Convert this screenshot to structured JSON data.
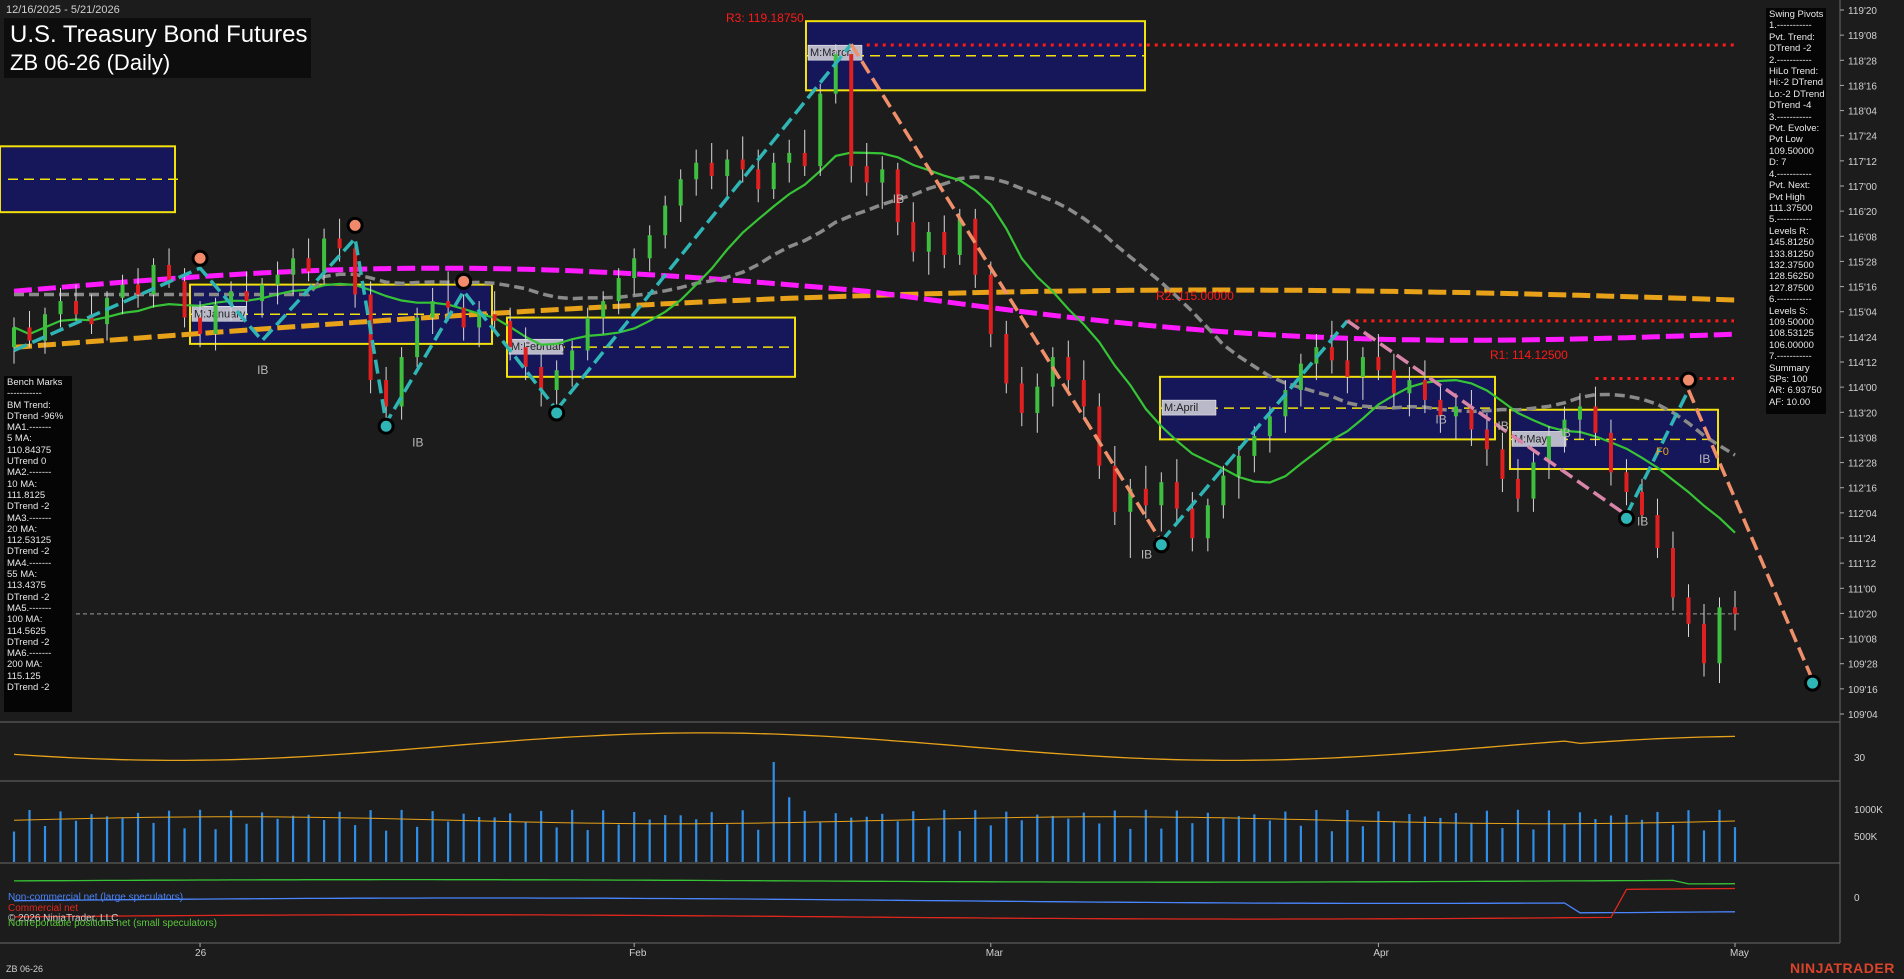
{
  "header": {
    "date_range": "12/16/2025 - 5/21/2026",
    "title": "U.S. Treasury Bond Futures",
    "subtitle": "ZB 06-26 (Daily)"
  },
  "bench_marks": {
    "lines": [
      "Bench Marks",
      "-----------",
      "BM Trend:",
      "DTrend -96%",
      "MA1.-------",
      "5 MA:",
      "110.84375",
      "UTrend 0",
      "MA2.-------",
      "10 MA:",
      "111.8125",
      "DTrend -2",
      "MA3.-------",
      "20 MA:",
      "112.53125",
      "DTrend -2",
      "MA4.-------",
      "55 MA:",
      "113.4375",
      "DTrend -2",
      "MA5.-------",
      "100 MA:",
      "114.5625",
      "DTrend -2",
      "MA6.-------",
      "200 MA:",
      "115.125",
      "DTrend -2"
    ]
  },
  "swing_pivots": {
    "lines": [
      "Swing Pivots",
      "1.-----------",
      "Pvt. Trend:",
      "DTrend -2",
      "2.-----------",
      "HiLo Trend:",
      "Hi:-2 DTrend",
      "Lo:-2 DTrend",
      "DTrend -4",
      "3.-----------",
      "Pvt. Evolve:",
      "Pvt Low",
      "109.50000",
      "D: 7",
      "4.-----------",
      "Pvt. Next:",
      "Pvt High",
      "111.37500",
      "5.-----------",
      "Levels R:",
      "145.81250",
      "133.81250",
      "132.37500",
      "128.56250",
      "127.87500",
      "6.-----------",
      "Levels S:",
      "109.50000",
      "108.53125",
      "106.00000",
      "7.-----------",
      "Summary",
      "SPs: 100",
      "AR: 6.93750",
      "AF: 10.00"
    ]
  },
  "footer": {
    "symbol": "ZB 06-26",
    "brand": "NINJATRADER",
    "copyright": "© 2026 NinjaTrader, LLC"
  },
  "legend": {
    "noncommercial": "Non-commercial net (large speculators)",
    "commercial": "Commercial net",
    "nonreportable": "Nonreportable positions net (small speculators)"
  },
  "colors": {
    "background": "#1c1c1c",
    "up_candle": "#3fbf3f",
    "down_candle": "#e02020",
    "magenta_ma": "#ff1aff",
    "orange_ma": "#e8a21a",
    "grey_ma": "#8a8a8a",
    "green_ma": "#36c436",
    "teal_swing": "#2fb5b5",
    "salmon_swing": "#f0906a",
    "period_box": "#16165a",
    "period_border": "#f2e10a",
    "resistance": "#ff1a1a"
  },
  "chart_data": [
    {
      "type": "candlestick",
      "panel": "price",
      "y_axis_ticks": [
        "119'20",
        "119'08",
        "118'28",
        "118'16",
        "118'04",
        "117'24",
        "117'12",
        "117'00",
        "116'20",
        "116'08",
        "115'28",
        "115'16",
        "115'04",
        "114'24",
        "114'12",
        "114'00",
        "113'20",
        "113'08",
        "112'28",
        "112'16",
        "112'04",
        "111'24",
        "111'12",
        "111'00",
        "110'20",
        "110'08",
        "109'28",
        "109'16",
        "109'04"
      ],
      "ylim": [
        109.0,
        119.75
      ],
      "x_axis_ticks": [
        "26",
        "Feb",
        "Mar",
        "Apr",
        "May"
      ],
      "resistance_levels": [
        {
          "label": "R3: 119.18750",
          "value": 119.1875
        },
        {
          "label": "R2: 115.00000",
          "value": 115.0
        },
        {
          "label": "R1: 114.12500",
          "value": 114.125
        }
      ],
      "period_boxes": [
        "M:January",
        "M:February",
        "M:March",
        "M:April",
        "M:May"
      ],
      "annotations": [
        "IB",
        "F0"
      ],
      "candles": [
        [
          114.6,
          115.05,
          114.35,
          114.9
        ],
        [
          114.9,
          115.15,
          114.6,
          114.7
        ],
        [
          114.7,
          115.2,
          114.5,
          115.1
        ],
        [
          115.1,
          115.5,
          114.9,
          115.3
        ],
        [
          115.3,
          115.55,
          115.0,
          115.1
        ],
        [
          115.1,
          115.4,
          114.8,
          114.95
        ],
        [
          114.95,
          115.45,
          114.7,
          115.35
        ],
        [
          115.35,
          115.7,
          115.1,
          115.55
        ],
        [
          115.55,
          115.8,
          115.2,
          115.4
        ],
        [
          115.4,
          115.95,
          115.2,
          115.85
        ],
        [
          115.85,
          116.1,
          115.5,
          115.6
        ],
        [
          115.6,
          115.8,
          114.9,
          115.05
        ],
        [
          115.05,
          115.3,
          114.6,
          114.8
        ],
        [
          114.8,
          115.35,
          114.55,
          115.25
        ],
        [
          115.25,
          115.6,
          115.0,
          115.45
        ],
        [
          115.45,
          115.75,
          115.1,
          115.3
        ],
        [
          115.3,
          115.65,
          115.05,
          115.55
        ],
        [
          115.55,
          115.9,
          115.25,
          115.7
        ],
        [
          115.7,
          116.1,
          115.4,
          115.95
        ],
        [
          115.95,
          116.25,
          115.6,
          115.75
        ],
        [
          115.75,
          116.4,
          115.55,
          116.25
        ],
        [
          116.25,
          116.55,
          115.9,
          116.1
        ],
        [
          116.1,
          116.2,
          115.2,
          115.4
        ],
        [
          115.4,
          115.6,
          113.9,
          114.1
        ],
        [
          114.1,
          114.3,
          113.4,
          113.7
        ],
        [
          113.7,
          114.6,
          113.5,
          114.45
        ],
        [
          114.45,
          115.2,
          114.3,
          115.05
        ],
        [
          115.05,
          115.5,
          114.8,
          115.3
        ],
        [
          115.3,
          115.75,
          115.0,
          115.2
        ],
        [
          115.2,
          115.4,
          114.7,
          114.9
        ],
        [
          114.9,
          115.3,
          114.6,
          115.1
        ],
        [
          115.1,
          115.45,
          114.85,
          115.0
        ],
        [
          115.0,
          115.2,
          114.4,
          114.6
        ],
        [
          114.6,
          114.9,
          114.1,
          114.3
        ],
        [
          114.3,
          114.5,
          113.7,
          113.95
        ],
        [
          113.95,
          114.4,
          113.65,
          114.25
        ],
        [
          114.25,
          114.7,
          114.0,
          114.55
        ],
        [
          114.55,
          115.2,
          114.4,
          115.05
        ],
        [
          115.05,
          115.45,
          114.8,
          115.3
        ],
        [
          115.3,
          115.8,
          115.1,
          115.65
        ],
        [
          115.65,
          116.1,
          115.4,
          115.95
        ],
        [
          115.95,
          116.45,
          115.75,
          116.3
        ],
        [
          116.3,
          116.9,
          116.1,
          116.75
        ],
        [
          116.75,
          117.3,
          116.5,
          117.15
        ],
        [
          117.15,
          117.6,
          116.9,
          117.4
        ],
        [
          117.4,
          117.7,
          117.0,
          117.2
        ],
        [
          117.2,
          117.6,
          116.9,
          117.45
        ],
        [
          117.45,
          117.8,
          117.1,
          117.3
        ],
        [
          117.3,
          117.6,
          116.8,
          117.0
        ],
        [
          117.0,
          117.55,
          116.85,
          117.4
        ],
        [
          117.4,
          117.75,
          117.1,
          117.55
        ],
        [
          117.55,
          117.9,
          117.2,
          117.35
        ],
        [
          117.35,
          118.6,
          117.2,
          118.45
        ],
        [
          118.45,
          119.2,
          118.3,
          119.05
        ],
        [
          119.05,
          119.2,
          117.1,
          117.35
        ],
        [
          117.35,
          117.7,
          116.9,
          117.1
        ],
        [
          117.1,
          117.5,
          116.7,
          117.3
        ],
        [
          117.3,
          117.4,
          116.3,
          116.5
        ],
        [
          116.5,
          116.8,
          115.9,
          116.05
        ],
        [
          116.05,
          116.5,
          115.7,
          116.35
        ],
        [
          116.35,
          116.6,
          115.8,
          116.0
        ],
        [
          116.0,
          116.7,
          115.85,
          116.55
        ],
        [
          116.55,
          116.7,
          115.5,
          115.7
        ],
        [
          115.7,
          115.9,
          114.6,
          114.8
        ],
        [
          114.8,
          115.0,
          113.9,
          114.05
        ],
        [
          114.05,
          114.3,
          113.4,
          113.6
        ],
        [
          113.6,
          114.2,
          113.3,
          114.0
        ],
        [
          114.0,
          114.6,
          113.7,
          114.45
        ],
        [
          114.45,
          114.7,
          113.9,
          114.1
        ],
        [
          114.1,
          114.4,
          113.5,
          113.7
        ],
        [
          113.7,
          113.9,
          112.6,
          112.8
        ],
        [
          112.8,
          113.1,
          111.9,
          112.1
        ],
        [
          112.1,
          112.6,
          111.4,
          112.45
        ],
        [
          112.45,
          112.8,
          112.0,
          112.2
        ],
        [
          112.2,
          112.7,
          111.8,
          112.55
        ],
        [
          112.55,
          112.9,
          111.95,
          112.15
        ],
        [
          112.15,
          112.4,
          111.5,
          111.7
        ],
        [
          111.7,
          112.3,
          111.5,
          112.2
        ],
        [
          112.2,
          112.8,
          112.0,
          112.65
        ],
        [
          112.65,
          113.1,
          112.3,
          112.95
        ],
        [
          112.95,
          113.4,
          112.7,
          113.25
        ],
        [
          113.25,
          113.7,
          113.0,
          113.55
        ],
        [
          113.55,
          114.1,
          113.3,
          113.95
        ],
        [
          113.95,
          114.5,
          113.7,
          114.35
        ],
        [
          114.35,
          114.8,
          114.1,
          114.6
        ],
        [
          114.6,
          115.0,
          114.2,
          114.4
        ],
        [
          114.4,
          114.7,
          113.9,
          114.15
        ],
        [
          114.15,
          114.6,
          113.8,
          114.45
        ],
        [
          114.45,
          114.8,
          114.1,
          114.25
        ],
        [
          114.25,
          114.5,
          113.7,
          113.9
        ],
        [
          113.9,
          114.3,
          113.55,
          114.1
        ],
        [
          114.1,
          114.4,
          113.6,
          113.8
        ],
        [
          113.8,
          114.05,
          113.3,
          113.55
        ],
        [
          113.55,
          113.9,
          113.2,
          113.7
        ],
        [
          113.7,
          113.95,
          113.1,
          113.35
        ],
        [
          113.35,
          113.6,
          112.8,
          113.05
        ],
        [
          113.05,
          113.3,
          112.4,
          112.6
        ],
        [
          112.6,
          112.9,
          112.1,
          112.3
        ],
        [
          112.3,
          113.0,
          112.1,
          112.85
        ],
        [
          112.85,
          113.4,
          112.6,
          113.25
        ],
        [
          113.25,
          113.7,
          113.0,
          113.5
        ],
        [
          113.5,
          113.9,
          113.2,
          113.7
        ],
        [
          113.7,
          114.0,
          113.1,
          113.3
        ],
        [
          113.3,
          113.5,
          112.5,
          112.7
        ],
        [
          112.7,
          112.9,
          112.2,
          112.4
        ],
        [
          112.4,
          112.6,
          111.9,
          112.05
        ],
        [
          112.05,
          112.3,
          111.4,
          111.55
        ],
        [
          111.55,
          111.8,
          110.6,
          110.8
        ],
        [
          110.8,
          111.0,
          110.2,
          110.4
        ],
        [
          110.4,
          110.7,
          109.6,
          109.8
        ],
        [
          109.8,
          110.8,
          109.5,
          110.65
        ],
        [
          110.65,
          110.9,
          110.3,
          110.55
        ]
      ]
    },
    {
      "type": "line",
      "panel": "oscillator",
      "y_axis_ticks": [
        "30"
      ]
    },
    {
      "type": "bar",
      "panel": "volume",
      "y_axis_ticks": [
        "1000K",
        "500K"
      ]
    },
    {
      "type": "line",
      "panel": "commitment_of_traders",
      "y_axis_ticks": [
        "0"
      ],
      "series": [
        {
          "name": "Non-commercial net (large speculators)"
        },
        {
          "name": "Commercial net"
        },
        {
          "name": "Nonreportable positions net (small speculators)"
        }
      ]
    }
  ]
}
